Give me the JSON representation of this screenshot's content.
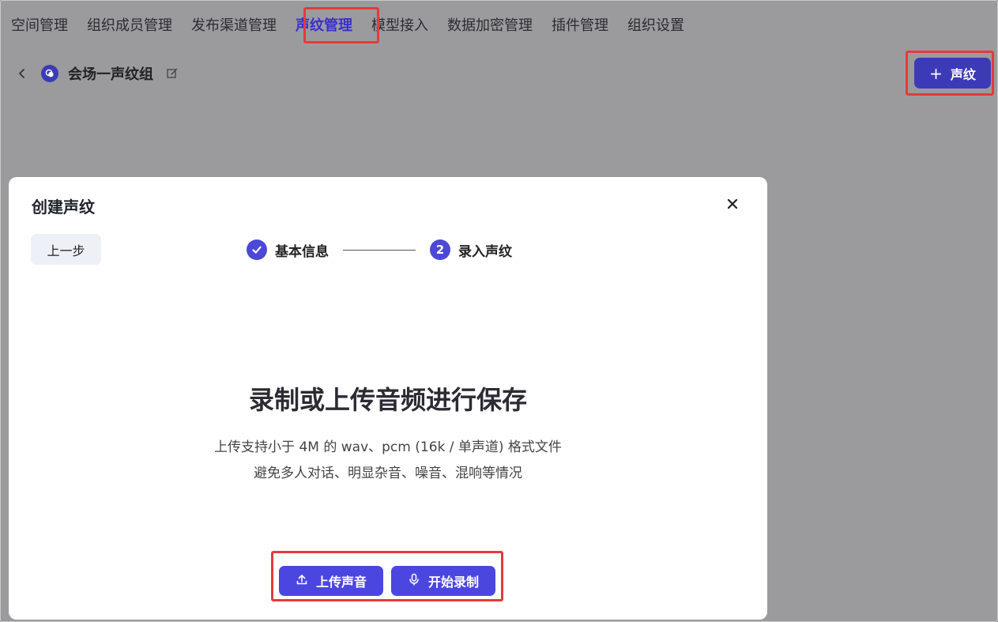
{
  "nav": {
    "tabs": [
      {
        "label": "空间管理"
      },
      {
        "label": "组织成员管理"
      },
      {
        "label": "发布渠道管理"
      },
      {
        "label": "声纹管理"
      },
      {
        "label": "模型接入"
      },
      {
        "label": "数据加密管理"
      },
      {
        "label": "插件管理"
      },
      {
        "label": "组织设置"
      }
    ],
    "active": "声纹管理"
  },
  "header": {
    "group_name": "会场一声纹组",
    "add_button_label": "声纹"
  },
  "modal": {
    "title": "创建声纹",
    "prev_label": "上一步",
    "steps": [
      {
        "label": "基本信息",
        "state": "done"
      },
      {
        "label": "录入声纹",
        "number": "2",
        "state": "current"
      }
    ],
    "headline": "录制或上传音频进行保存",
    "desc_line1": "上传支持小于 4M 的 wav、pcm (16k / 单声道) 格式文件",
    "desc_line2": "避免多人对话、明显杂音、噪音、混响等情况",
    "upload_label": "上传声音",
    "record_label": "开始录制"
  },
  "colors": {
    "accent": "#4c46e0",
    "active_tab": "#3b2fc9",
    "highlight": "#e53a3a",
    "overlay": "#9b9b9e"
  }
}
